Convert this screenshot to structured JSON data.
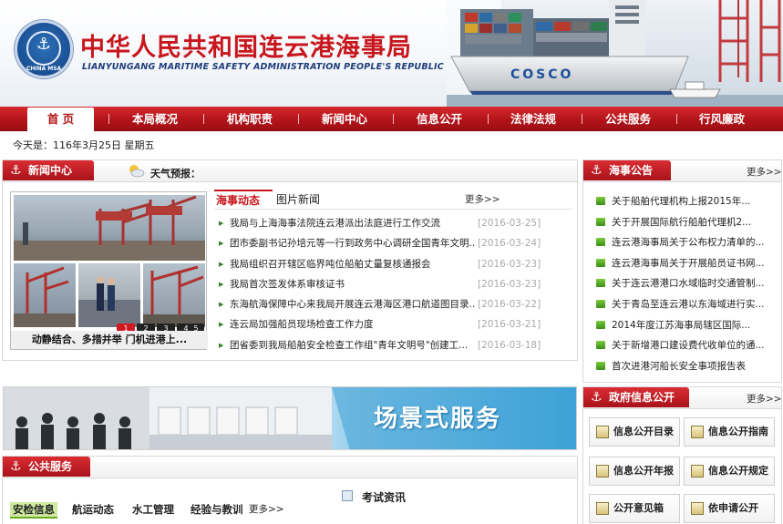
{
  "header": {
    "logo_ring_text": "CHINA MSA",
    "title": "中华人民共和国连云港海事局",
    "subtitle": "LIANYUNGANG MARITIME SAFETY ADMINISTRATION PEOPLE'S REPUBLIC OF CHINA",
    "ship_text": "COSCO"
  },
  "nav": {
    "items": [
      "首 页",
      "本局概况",
      "机构职责",
      "新闻中心",
      "信息公开",
      "法律法规",
      "公共服务",
      "行风廉政"
    ]
  },
  "datebar": {
    "text": "今天是：116年3月25日  星期五"
  },
  "news_center": {
    "header": "新闻中心",
    "weather_label": "天气预报：",
    "tabs": [
      "海事动态",
      "图片新闻"
    ],
    "more": "更多>>",
    "photo_caption": "动静结合、多措并举 门机进港上...",
    "pager": [
      "1",
      "2",
      "3",
      "4",
      "5"
    ],
    "items": [
      {
        "title": "我局与上海海事法院连云港派出法庭进行工作交流",
        "date": "[2016-03-25]"
      },
      {
        "title": "团市委副书记孙培元等一行到政务中心调研全国青年文明...",
        "date": "[2016-03-24]"
      },
      {
        "title": "我局组织召开辖区临界吨位船舶丈量复核通报会",
        "date": "[2016-03-23]"
      },
      {
        "title": "我局首次签发体系审核证书",
        "date": "[2016-03-23]"
      },
      {
        "title": "东海航海保障中心来我局开展连云港海区港口航道图目录...",
        "date": "[2016-03-22]"
      },
      {
        "title": "连云局加强船员现场检查工作力度",
        "date": "[2016-03-21]"
      },
      {
        "title": "团省委到我局船舶安全检查工作组\"青年文明号\"创建工...",
        "date": "[2016-03-18]"
      }
    ]
  },
  "notices": {
    "header": "海事公告",
    "more": "更多>>",
    "items": [
      "关于船舶代理机构上报2015年...",
      "关于开展国际航行船舶代理机2...",
      "连云港海事局关于公布权力清单的...",
      "连云港海事局关于开展船员证书网...",
      "关于连云港港口水域临时交通管制...",
      "关于青岛至连云港以东海域进行实...",
      "2014年度江苏海事局辖区国际...",
      "关于新增港口建设费代收单位的通...",
      "首次进港河船长安全事项报告表"
    ]
  },
  "banner": {
    "text": "场景式服务"
  },
  "public_service": {
    "header": "公共服务",
    "tabs": [
      "安检信息",
      "航运动态",
      "水工管理",
      "经验与教训"
    ],
    "more": "更多>>",
    "exam_label": "考试资讯"
  },
  "gov_info": {
    "header": "政府信息公开",
    "more": "更多>>",
    "buttons": [
      "信息公开目录",
      "信息公开指南",
      "信息公开年报",
      "信息公开规定",
      "公开意见箱",
      "依申请公开"
    ]
  },
  "colors": {
    "brand_red": "#c8161d",
    "nav_red": "#b3141a",
    "date_gray": "#a9a9a9",
    "bullet_green": "#3c8d17"
  }
}
